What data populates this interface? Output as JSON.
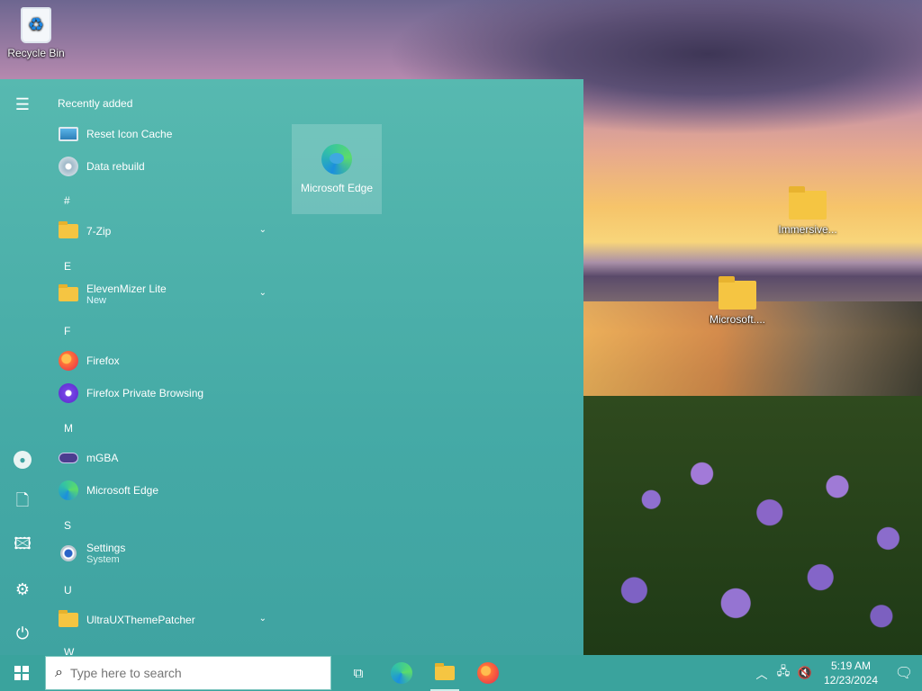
{
  "desktop": {
    "recycle_bin": "Recycle Bin",
    "folder_immersive": "Immersive...",
    "folder_microsoft": "Microsoft...."
  },
  "start_menu": {
    "list_title": "Recently added",
    "items": [
      {
        "label": "Reset Icon Cache",
        "icon": "monitor-icon"
      },
      {
        "label": "Data rebuild",
        "icon": "disc-icon"
      },
      {
        "label": "7-Zip",
        "icon": "folder-icon"
      },
      {
        "label": "ElevenMizer Lite",
        "sub": "New",
        "icon": "folder-icon"
      },
      {
        "label": "Firefox",
        "icon": "firefox-icon"
      },
      {
        "label": "Firefox Private Browsing",
        "icon": "firefox-private-icon"
      },
      {
        "label": "mGBA",
        "icon": "gamepad-icon"
      },
      {
        "label": "Microsoft Edge",
        "icon": "edge-icon"
      },
      {
        "label": "Settings",
        "sub": "System",
        "icon": "settings-icon"
      },
      {
        "label": "UltraUXThemePatcher",
        "icon": "folder-icon"
      }
    ],
    "letters": [
      "#",
      "E",
      "F",
      "M",
      "S",
      "U",
      "W"
    ],
    "tile_label": "Microsoft Edge"
  },
  "taskbar": {
    "search_placeholder": "Type here to search",
    "time": "5:19 AM",
    "date": "12/23/2024"
  }
}
